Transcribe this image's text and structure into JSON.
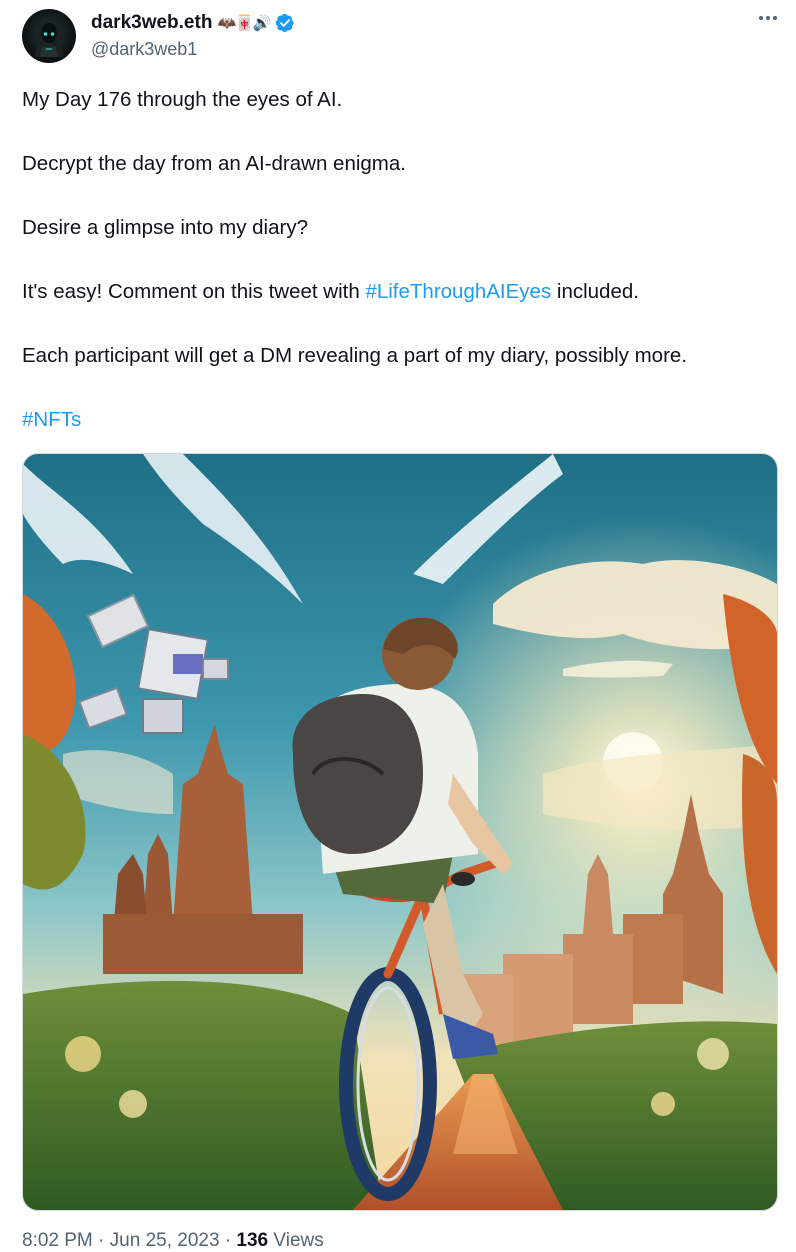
{
  "author": {
    "display_name": "dark3web.eth",
    "name_emojis": "🦇🀄🔊",
    "handle": "@dark3web1"
  },
  "tweet": {
    "paragraphs": [
      {
        "parts": [
          {
            "text": "My Day 176 through the eyes of AI."
          }
        ]
      },
      {
        "parts": [
          {
            "text": "Decrypt the day from an AI-drawn enigma."
          }
        ]
      },
      {
        "parts": [
          {
            "text": "Desire a glimpse into my diary?"
          }
        ]
      },
      {
        "parts": [
          {
            "text": "It's easy! Comment on this tweet with "
          },
          {
            "text": "#LifeThroughAIEyes",
            "hashtag": true
          },
          {
            "text": " included."
          }
        ]
      },
      {
        "parts": [
          {
            "text": "Each participant will get a DM revealing a part of my diary, possibly more."
          }
        ]
      },
      {
        "parts": [
          {
            "text": "#NFTs",
            "hashtag": true
          }
        ]
      }
    ]
  },
  "meta": {
    "time": "8:02 PM",
    "separator_1": " · ",
    "date": "Jun 25, 2023",
    "separator_2": " · ",
    "views_count": "136",
    "views_label": " Views"
  },
  "colors": {
    "link": "#1d9bf0",
    "text": "#0f1419",
    "secondary": "#536471",
    "verified": "#1d9bf0"
  },
  "icons": {
    "verified": "verified-badge-icon",
    "more": "more-horizontal-icon"
  }
}
